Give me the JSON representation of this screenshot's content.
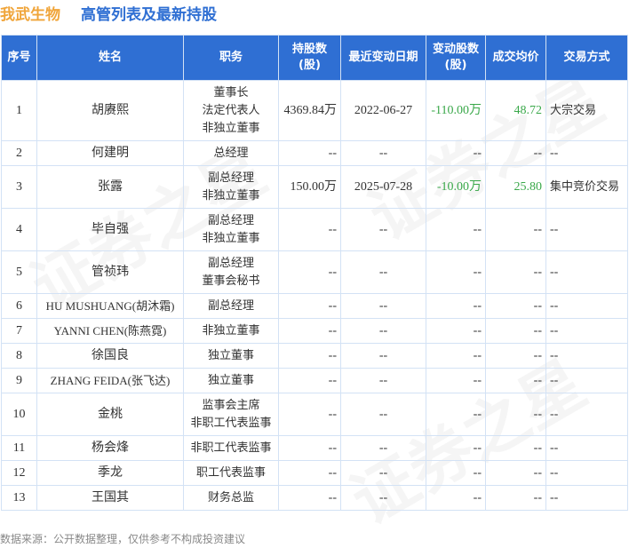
{
  "header": {
    "company": "我武生物",
    "title": "高管列表及最新持股"
  },
  "table": {
    "columns": [
      "序号",
      "姓名",
      "职务",
      "持股数(股)",
      "最近变动日期",
      "变动股数(股)",
      "成交均价",
      "交易方式"
    ],
    "col_lines": {
      "shares": [
        "持股数",
        "(股)"
      ],
      "change": [
        "变动股数",
        "(股)"
      ]
    },
    "rows": [
      {
        "no": "1",
        "name": "胡赓熙",
        "roles": [
          "董事长",
          "法定代表人",
          "非独立董事"
        ],
        "shares": "4369.84万",
        "date": "2022-06-27",
        "change": "-110.00万",
        "price": "48.72",
        "method": "大宗交易"
      },
      {
        "no": "2",
        "name": "何建明",
        "roles": [
          "总经理"
        ],
        "shares": "--",
        "date": "--",
        "change": "--",
        "price": "--",
        "method": "--"
      },
      {
        "no": "3",
        "name": "张露",
        "roles": [
          "副总经理",
          "非独立董事"
        ],
        "shares": "150.00万",
        "date": "2025-07-28",
        "change": "-10.00万",
        "price": "25.80",
        "method": "集中竞价交易"
      },
      {
        "no": "4",
        "name": "毕自强",
        "roles": [
          "副总经理",
          "非独立董事"
        ],
        "shares": "--",
        "date": "--",
        "change": "--",
        "price": "--",
        "method": "--"
      },
      {
        "no": "5",
        "name": "管祯玮",
        "roles": [
          "副总经理",
          "董事会秘书"
        ],
        "shares": "--",
        "date": "--",
        "change": "--",
        "price": "--",
        "method": "--"
      },
      {
        "no": "6",
        "name": "HU MUSHUANG(胡沐霜)",
        "roles": [
          "副总经理"
        ],
        "shares": "--",
        "date": "--",
        "change": "--",
        "price": "--",
        "method": "--"
      },
      {
        "no": "7",
        "name": "YANNI CHEN(陈燕霓)",
        "roles": [
          "非独立董事"
        ],
        "shares": "--",
        "date": "--",
        "change": "--",
        "price": "--",
        "method": "--"
      },
      {
        "no": "8",
        "name": "徐国良",
        "roles": [
          "独立董事"
        ],
        "shares": "--",
        "date": "--",
        "change": "--",
        "price": "--",
        "method": "--"
      },
      {
        "no": "9",
        "name": "ZHANG FEIDA(张飞达)",
        "roles": [
          "独立董事"
        ],
        "shares": "--",
        "date": "--",
        "change": "--",
        "price": "--",
        "method": "--"
      },
      {
        "no": "10",
        "name": "金桃",
        "roles": [
          "监事会主席",
          "非职工代表监事"
        ],
        "shares": "--",
        "date": "--",
        "change": "--",
        "price": "--",
        "method": "--"
      },
      {
        "no": "11",
        "name": "杨会烽",
        "roles": [
          "非职工代表监事"
        ],
        "shares": "--",
        "date": "--",
        "change": "--",
        "price": "--",
        "method": "--"
      },
      {
        "no": "12",
        "name": "季龙",
        "roles": [
          "职工代表监事"
        ],
        "shares": "--",
        "date": "--",
        "change": "--",
        "price": "--",
        "method": "--"
      },
      {
        "no": "13",
        "name": "王国其",
        "roles": [
          "财务总监"
        ],
        "shares": "--",
        "date": "--",
        "change": "--",
        "price": "--",
        "method": "--"
      }
    ]
  },
  "footer": "数据来源：公开数据整理，仅供参考不构成投资建议",
  "watermark": "证券之星",
  "colors": {
    "header_bg": "#2f6fd3",
    "company": "#f0a53a",
    "title": "#2f6fd3",
    "change_value": "#3aa84a"
  }
}
